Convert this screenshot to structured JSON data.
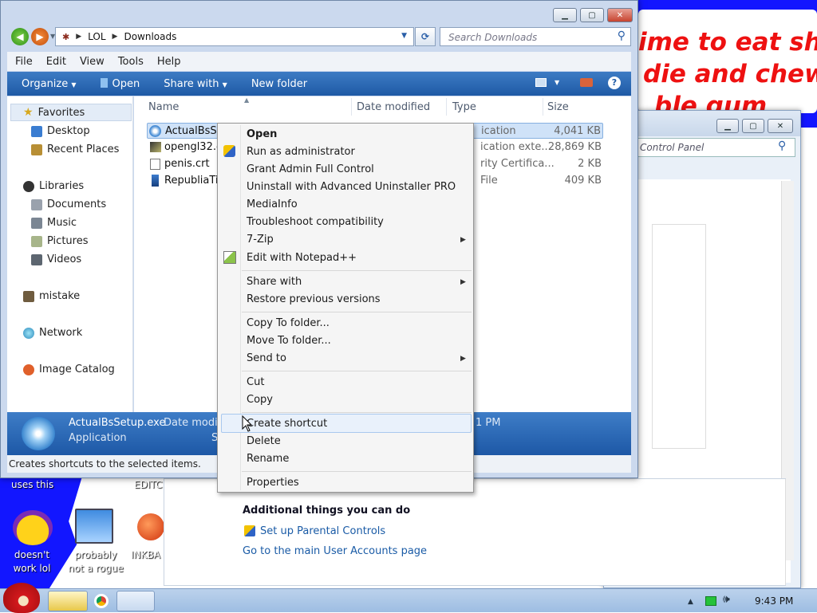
{
  "wallpaper": {
    "top_right_lines": [
      "ime to eat shit",
      "die and chew",
      "ble gum"
    ],
    "bottom_left_text_1": "uses this",
    "bottom_left_text_2": "EDITC",
    "icons": [
      {
        "label_1": "doesn't",
        "label_2": "work lol"
      },
      {
        "label_1": "probably",
        "label_2": "not a rogue"
      },
      {
        "label_1": "INKBA",
        "label_2": ""
      }
    ]
  },
  "control_panel": {
    "search_placeholder": "Control Panel",
    "additional_title": "Additional things you can do",
    "parental_link": "Set up Parental Controls",
    "accounts_link": "Go to the main User Accounts page"
  },
  "explorer": {
    "breadcrumb": [
      "LOL",
      "Downloads"
    ],
    "search_placeholder": "Search Downloads",
    "menu": [
      "File",
      "Edit",
      "View",
      "Tools",
      "Help"
    ],
    "toolbar": {
      "organize": "Organize",
      "open": "Open",
      "share": "Share with",
      "new_folder": "New folder"
    },
    "nav": {
      "favorites": "Favorites",
      "desktop": "Desktop",
      "recent": "Recent Places",
      "libraries": "Libraries",
      "documents": "Documents",
      "music": "Music",
      "pictures": "Pictures",
      "videos": "Videos",
      "mistake": "mistake",
      "network": "Network",
      "image_catalog": "Image Catalog"
    },
    "columns": {
      "name": "Name",
      "date": "Date modified",
      "type": "Type",
      "size": "Size"
    },
    "files": [
      {
        "name": "ActualBsSet",
        "type": "ication",
        "size": "4,041 KB"
      },
      {
        "name": "opengl32.d",
        "type": "ication exte...",
        "size": "28,869 KB"
      },
      {
        "name": "penis.crt",
        "type": "rity Certifica...",
        "size": "2 KB"
      },
      {
        "name": "RepubliaTir",
        "type": "File",
        "size": "409 KB"
      }
    ],
    "details": {
      "filename": "ActualBsSetup.exe",
      "date_label": "Date modifi",
      "kind": "Application",
      "s_label": "S",
      "time": "1 PM"
    },
    "status": "Creates shortcuts to the selected items."
  },
  "context_menu": {
    "open": "Open",
    "run_admin": "Run as administrator",
    "grant": "Grant Admin Full Control",
    "uninstall": "Uninstall with Advanced Uninstaller PRO",
    "mediainfo": "MediaInfo",
    "troubleshoot": "Troubleshoot compatibility",
    "zip": "7-Zip",
    "notepad": "Edit with Notepad++",
    "share": "Share with",
    "restore": "Restore previous versions",
    "copy_to": "Copy To folder...",
    "move_to": "Move To folder...",
    "send_to": "Send to",
    "cut": "Cut",
    "copy": "Copy",
    "create_shortcut": "Create shortcut",
    "delete": "Delete",
    "rename": "Rename",
    "properties": "Properties"
  },
  "taskbar": {
    "clock": "9:43 PM"
  },
  "colors": {
    "accent": "#1f5aa5",
    "wall_blue": "#1216ff",
    "wall_red": "#e11111"
  }
}
